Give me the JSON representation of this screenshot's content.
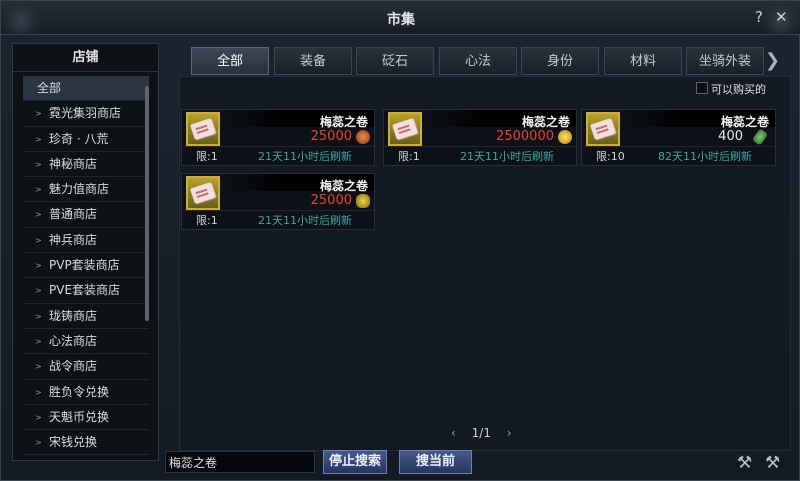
{
  "window": {
    "title": "市集",
    "help_label": "?",
    "close_label": "✕"
  },
  "shop": {
    "header": "店铺",
    "items": [
      "全部",
      "霓光集羽商店",
      "珍奇 · 八荒",
      "神秘商店",
      "魅力值商店",
      "普通商店",
      "神兵商店",
      "PVP套装商店",
      "PVE套装商店",
      "珑铸商店",
      "心法商店",
      "战令商店",
      "胜负令兑换",
      "天魁币兑换",
      "宋钱兑换"
    ]
  },
  "tabs": [
    "全部",
    "装备",
    "砭石",
    "心法",
    "身份",
    "材料",
    "坐骑外装"
  ],
  "filter": {
    "buyable_label": "可以购买的"
  },
  "items": [
    {
      "name": "梅蕊之卷",
      "price": "25000",
      "price_color": "red",
      "currency_icon": "copper-coin-icon",
      "limit": "限:1",
      "refresh": "21天11小时后刷新"
    },
    {
      "name": "梅蕊之卷",
      "price": "2500000",
      "price_color": "red",
      "currency_icon": "gold-coin-icon",
      "limit": "限:1",
      "refresh": "21天11小时后刷新"
    },
    {
      "name": "梅蕊之卷",
      "price": "400",
      "price_color": "white",
      "currency_icon": "jade-token-icon",
      "limit": "限:10",
      "refresh": "82天11小时后刷新"
    },
    {
      "name": "梅蕊之卷",
      "price": "25000",
      "price_color": "red",
      "currency_icon": "gold-ingot-icon",
      "limit": "限:1",
      "refresh": "21天11小时后刷新"
    }
  ],
  "pager": {
    "prev": "‹",
    "page": "1/1",
    "next": "›"
  },
  "search": {
    "value": "梅蕊之卷"
  },
  "buttons": {
    "stop_search": "停止搜索",
    "search_current": "搜当前"
  }
}
